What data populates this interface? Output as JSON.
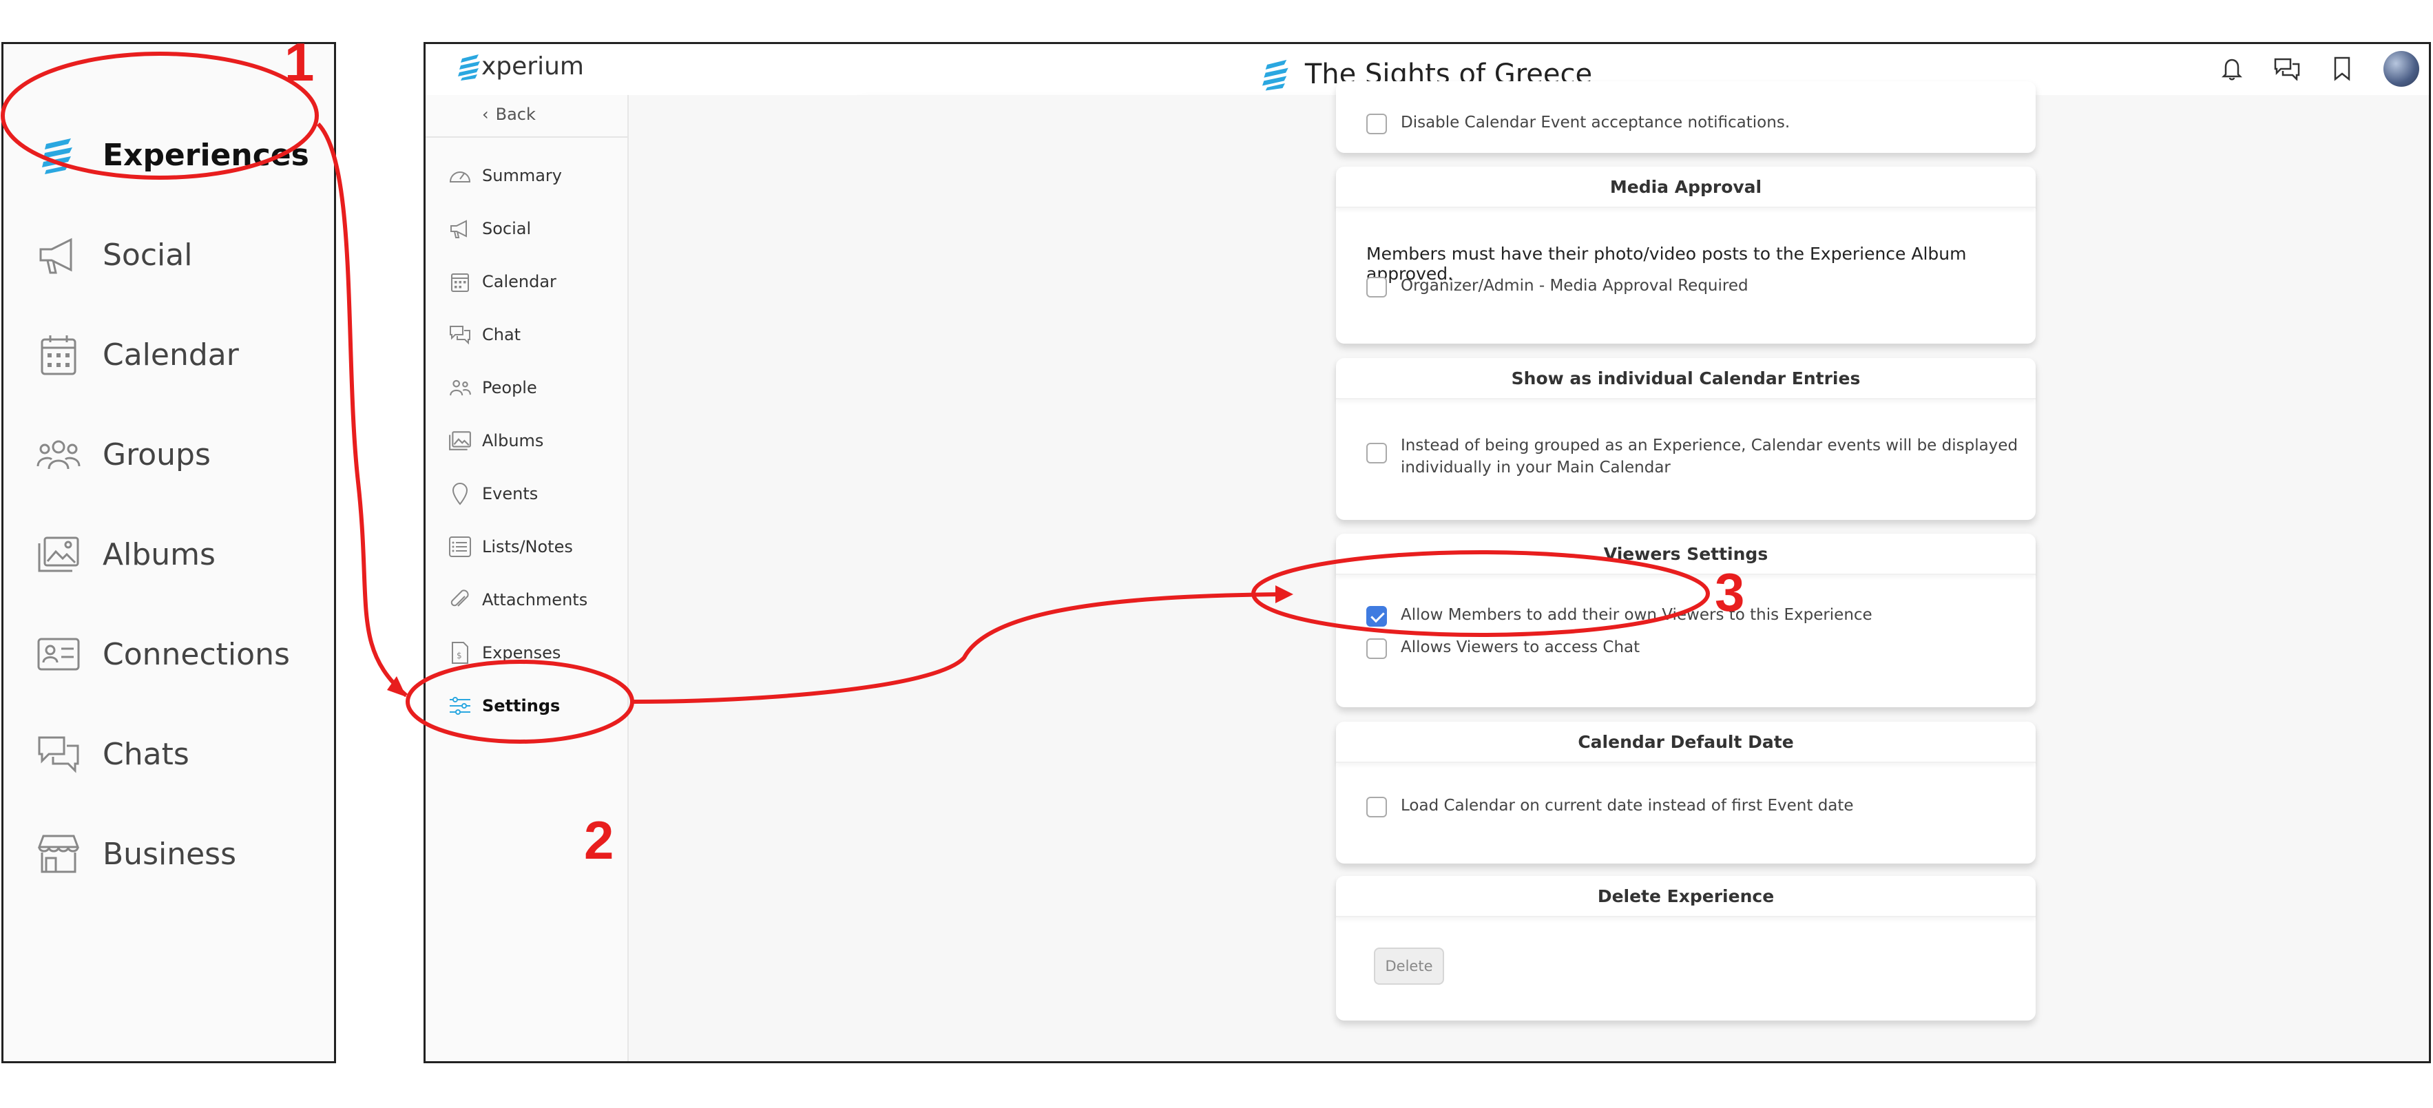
{
  "left_panel": {
    "items": [
      {
        "label": "Experiences",
        "icon": "experium-logo-icon",
        "bold": true
      },
      {
        "label": "Social",
        "icon": "megaphone-icon"
      },
      {
        "label": "Calendar",
        "icon": "calendar-icon"
      },
      {
        "label": "Groups",
        "icon": "groups-icon"
      },
      {
        "label": "Albums",
        "icon": "albums-icon"
      },
      {
        "label": "Connections",
        "icon": "contact-card-icon"
      },
      {
        "label": "Chats",
        "icon": "chat-bubbles-icon"
      },
      {
        "label": "Business",
        "icon": "storefront-icon"
      }
    ]
  },
  "app": {
    "brand": "xperium",
    "title": "The Sights of Greece",
    "top_icons": [
      "bell-icon",
      "chat-icon",
      "bookmark-icon",
      "avatar"
    ]
  },
  "sidebar": {
    "back_label": "Back",
    "items": [
      {
        "label": "Summary",
        "icon": "speedometer-icon"
      },
      {
        "label": "Social",
        "icon": "megaphone-icon"
      },
      {
        "label": "Calendar",
        "icon": "calendar-icon"
      },
      {
        "label": "Chat",
        "icon": "chat-bubbles-icon"
      },
      {
        "label": "People",
        "icon": "people-icon"
      },
      {
        "label": "Albums",
        "icon": "albums-icon"
      },
      {
        "label": "Events",
        "icon": "location-pin-icon"
      },
      {
        "label": "Lists/Notes",
        "icon": "list-icon"
      },
      {
        "label": "Attachments",
        "icon": "paperclip-icon"
      },
      {
        "label": "Expenses",
        "icon": "receipt-icon"
      },
      {
        "label": "Settings",
        "icon": "sliders-icon",
        "active": true
      }
    ]
  },
  "cards": {
    "top_partial": {
      "option": "Disable Calendar Event acceptance notifications.",
      "checked": false
    },
    "media_approval": {
      "title": "Media Approval",
      "description": "Members must have their photo/video posts to the Experience Album approved.",
      "option": "Organizer/Admin - Media Approval Required",
      "checked": false
    },
    "individual_entries": {
      "title": "Show as individual Calendar Entries",
      "option_line1": "Instead of being grouped as an Experience, Calendar events will be displayed",
      "option_line2": "individually in your Main Calendar",
      "checked": false
    },
    "viewers_settings": {
      "title": "Viewers Settings",
      "options": [
        {
          "label": "Allow Members to add their own Viewers to this Experience",
          "checked": true
        },
        {
          "label": "Allows Viewers to access Chat",
          "checked": false
        }
      ]
    },
    "calendar_default_date": {
      "title": "Calendar Default Date",
      "option": "Load Calendar on current date instead of first Event date",
      "checked": false
    },
    "delete_experience": {
      "title": "Delete Experience",
      "button": "Delete"
    }
  },
  "annotations": {
    "steps": [
      "1",
      "2",
      "3"
    ],
    "color": "#e81e1e"
  },
  "colors": {
    "accent": "#3f7be0",
    "brand": "#2aa7e0",
    "annotation": "#e81e1e"
  }
}
